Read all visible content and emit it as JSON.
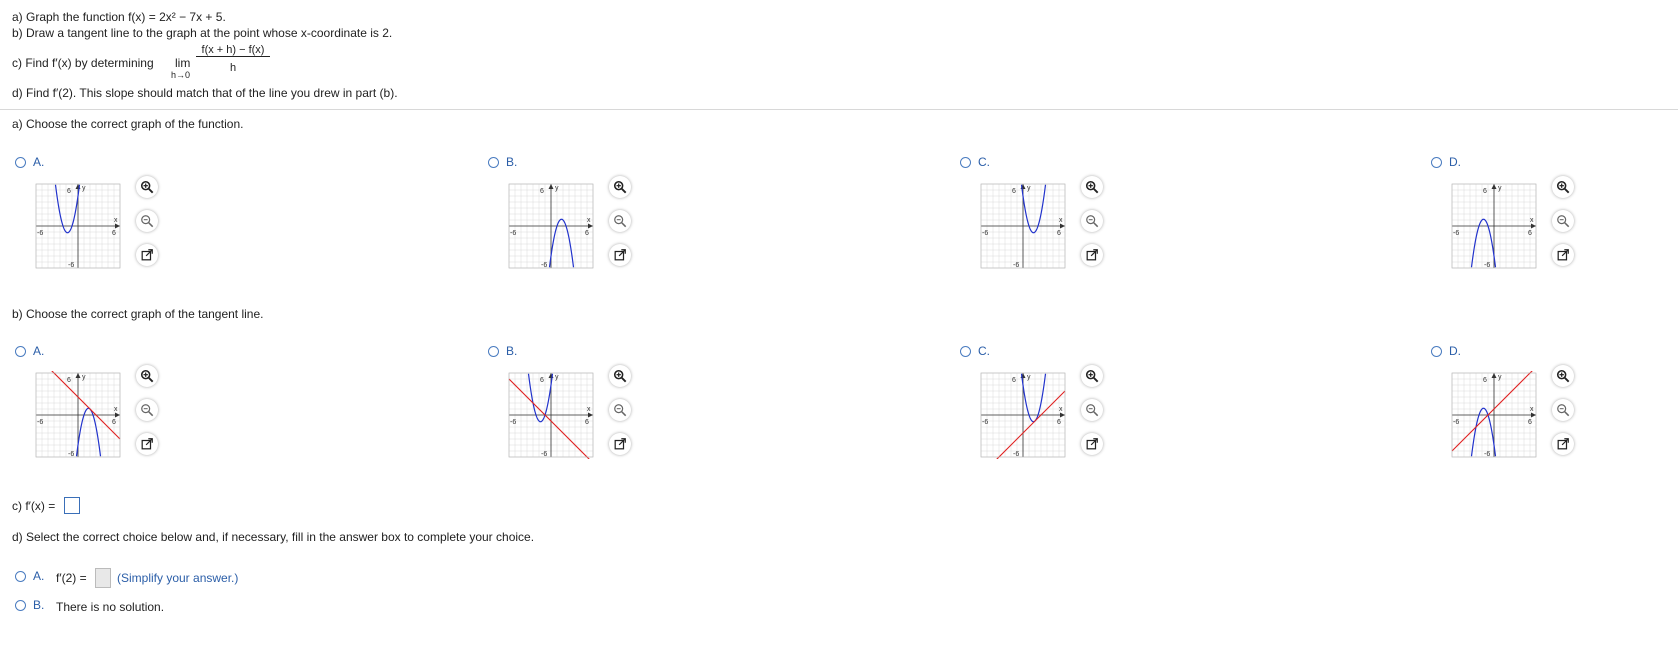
{
  "question": {
    "line_a": "a) Graph the function f(x) = 2x² − 7x + 5.",
    "line_b": "b) Draw a tangent line to the graph at the point whose x-coordinate is 2.",
    "line_c_pre": "c) Find f′(x) by determining",
    "lim_word": "lim",
    "lim_sub": "h→0",
    "lim_num": "f(x + h) − f(x)",
    "lim_den": "h",
    "line_d": "d) Find f′(2). This slope should match that of the line you drew in part (b)."
  },
  "part_a": {
    "prompt": "a) Choose the correct graph of the function.",
    "options": [
      {
        "label": "A."
      },
      {
        "label": "B."
      },
      {
        "label": "C."
      },
      {
        "label": "D."
      }
    ]
  },
  "part_b": {
    "prompt": "b) Choose the correct graph of the tangent line.",
    "options": [
      {
        "label": "A."
      },
      {
        "label": "B."
      },
      {
        "label": "C."
      },
      {
        "label": "D."
      }
    ]
  },
  "graph_axis": {
    "tick_pos": "6",
    "tick_neg": "-6",
    "x_label": "x",
    "y_label": "y"
  },
  "part_c": {
    "label": "c) f′(x) ="
  },
  "part_d": {
    "prompt": "d) Select the correct choice below and, if necessary, fill in the answer box to complete your choice.",
    "option_a_label": "A.",
    "option_a_text": "f′(2) =",
    "option_a_hint": "(Simplify your answer.)",
    "option_b_label": "B.",
    "option_b_text": "There is no solution."
  },
  "icons": [
    "zoom-in-icon",
    "zoom-out-icon",
    "popout-icon"
  ],
  "colors": {
    "curve": "#2233cc",
    "tangent": "#e02020",
    "accent": "#2b5ea8"
  }
}
